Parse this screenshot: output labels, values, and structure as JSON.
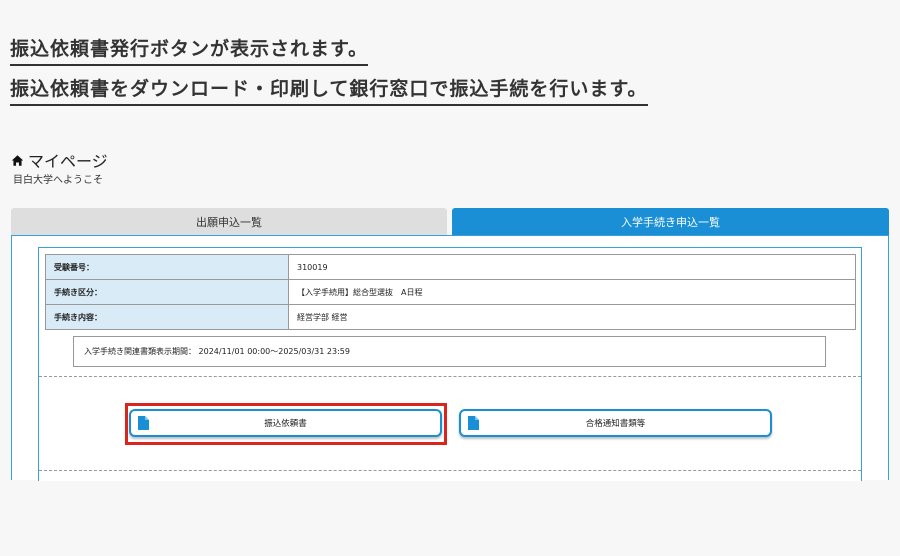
{
  "instructions": {
    "line1": "振込依頼書発行ボタンが表示されます。",
    "line2": "振込依頼書をダウンロード・印刷して銀行窓口で振込手続を行います。"
  },
  "mypage": {
    "icon": "home-icon",
    "title": "マイページ",
    "welcome": "目白大学へようこそ"
  },
  "tabs": [
    {
      "label": "出願申込一覧",
      "active": false
    },
    {
      "label": "入学手続き申込一覧",
      "active": true
    }
  ],
  "application": {
    "rows": [
      {
        "label": "受験番号：",
        "value": "310019"
      },
      {
        "label": "手続き区分：",
        "value": "【入学手続用】総合型選抜　A日程"
      },
      {
        "label": "手続き内容：",
        "value": "経営学部 経営"
      }
    ],
    "period": "入学手続き関連書類表示期間： 2024/11/01 00:00～2025/03/31 23:59"
  },
  "buttons": {
    "furikomi": {
      "label": "振込依頼書",
      "icon": "file-icon"
    },
    "goukaku": {
      "label": "合格通知書類等",
      "icon": "file-icon"
    }
  },
  "colors": {
    "accent": "#1a8fd6",
    "highlight": "#d9251c",
    "label_bg": "#d8ebf7"
  }
}
